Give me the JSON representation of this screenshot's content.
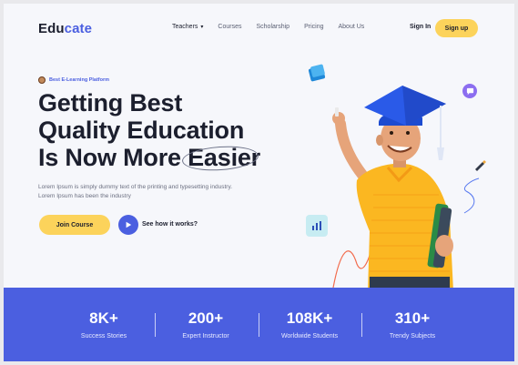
{
  "brand": {
    "prefix": "Edu",
    "suffix": "cate"
  },
  "nav": {
    "items": [
      {
        "label": "Teachers"
      },
      {
        "label": "Courses"
      },
      {
        "label": "Scholarship"
      },
      {
        "label": "Pricing"
      },
      {
        "label": "About Us"
      }
    ],
    "signin_label": "Sign In",
    "signup_label": "Sign up"
  },
  "hero": {
    "badge": "Best E-Learning Platform",
    "headline_line1": "Getting Best",
    "headline_line2": "Quality Education",
    "headline_line3_prefix": "Is Now More ",
    "headline_highlight": "Easier",
    "description": "Lorem Ipsum is simply dummy text of the printing and typesetting industry. Lorem Ipsum has been the industry",
    "join_label": "Join Course",
    "how_label": "See how it works?"
  },
  "stats": [
    {
      "value": "8K+",
      "label": "Success Stories"
    },
    {
      "value": "200+",
      "label": "Expert Instructor"
    },
    {
      "value": "108K+",
      "label": "Worldwide Students"
    },
    {
      "value": "310+",
      "label": "Trendy Subjects"
    }
  ],
  "colors": {
    "accent": "#4b5fe0",
    "yellow": "#fcd35b",
    "dark": "#1c1f2e"
  }
}
